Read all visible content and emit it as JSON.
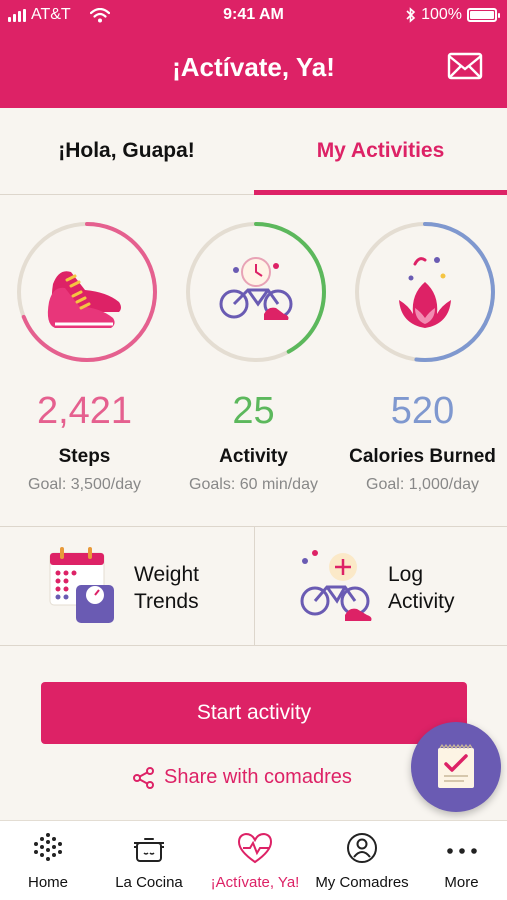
{
  "status_bar": {
    "carrier": "AT&T",
    "time": "9:41 AM",
    "battery": "100%"
  },
  "header": {
    "title": "¡Actívate, Ya!",
    "mail_icon": "mail-icon"
  },
  "tabs": [
    {
      "label": "¡Hola, Guapa!",
      "active": false
    },
    {
      "label": "My Activities",
      "active": true
    }
  ],
  "stats": [
    {
      "value": "2,421",
      "label": "Steps",
      "goal": "Goal: 3,500/day",
      "color": "#e5608f",
      "progress": 0.69,
      "icon": "sneakers-icon"
    },
    {
      "value": "25",
      "label": "Activity",
      "goal": "Goals: 60 min/day",
      "color": "#5cb85c",
      "progress": 0.42,
      "icon": "bike-clock-icon"
    },
    {
      "value": "520",
      "label": "Calories Burned",
      "goal": "Goal: 1,000/day",
      "color": "#7f98cf",
      "progress": 0.52,
      "icon": "flame-icon"
    }
  ],
  "quick_actions": [
    {
      "label_line1": "Weight",
      "label_line2": "Trends",
      "icon": "calendar-scale-icon"
    },
    {
      "label_line1": "Log",
      "label_line2": "Activity",
      "icon": "bike-plus-icon"
    }
  ],
  "start_button": "Start activity",
  "share": {
    "label": "Share with comadres",
    "icon": "share-icon"
  },
  "fab_icon": "notepad-icon",
  "bottom_nav": [
    {
      "label": "Home",
      "icon": "home-icon",
      "active": false
    },
    {
      "label": "La Cocina",
      "icon": "cooking-pot-icon",
      "active": false
    },
    {
      "label": "¡Actívate, Ya!",
      "icon": "heart-pulse-icon",
      "active": true
    },
    {
      "label": "My Comadres",
      "icon": "comadres-icon",
      "active": false
    },
    {
      "label": "More",
      "icon": "more-icon",
      "active": false
    }
  ],
  "colors": {
    "brand": "#dd2266",
    "background": "#f8f5f0",
    "fab": "#6a5bb3"
  }
}
